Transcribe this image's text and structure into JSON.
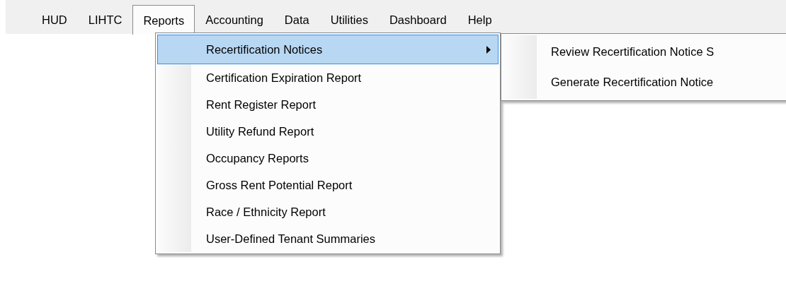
{
  "menu_bar": [
    {
      "label": "HUD",
      "selected": false
    },
    {
      "label": "LIHTC",
      "selected": false
    },
    {
      "label": "Reports",
      "selected": true
    },
    {
      "label": "Accounting",
      "selected": false
    },
    {
      "label": "Data",
      "selected": false
    },
    {
      "label": "Utilities",
      "selected": false
    },
    {
      "label": "Dashboard",
      "selected": false
    },
    {
      "label": "Help",
      "selected": false
    }
  ],
  "reports_menu": [
    {
      "label": "Recertification Notices",
      "selected": true,
      "has_submenu": true
    },
    {
      "label": "Certification Expiration Report",
      "selected": false,
      "has_submenu": false
    },
    {
      "label": "Rent Register Report",
      "selected": false,
      "has_submenu": false
    },
    {
      "label": "Utility Refund Report",
      "selected": false,
      "has_submenu": false
    },
    {
      "label": "Occupancy Reports",
      "selected": false,
      "has_submenu": false
    },
    {
      "label": "Gross Rent Potential Report",
      "selected": false,
      "has_submenu": false
    },
    {
      "label": "Race / Ethnicity Report",
      "selected": false,
      "has_submenu": false
    },
    {
      "label": "User-Defined Tenant Summaries",
      "selected": false,
      "has_submenu": false
    }
  ],
  "submenu": [
    {
      "label": "Review Recertification Notice S"
    },
    {
      "label": "Generate Recertification Notice"
    }
  ]
}
